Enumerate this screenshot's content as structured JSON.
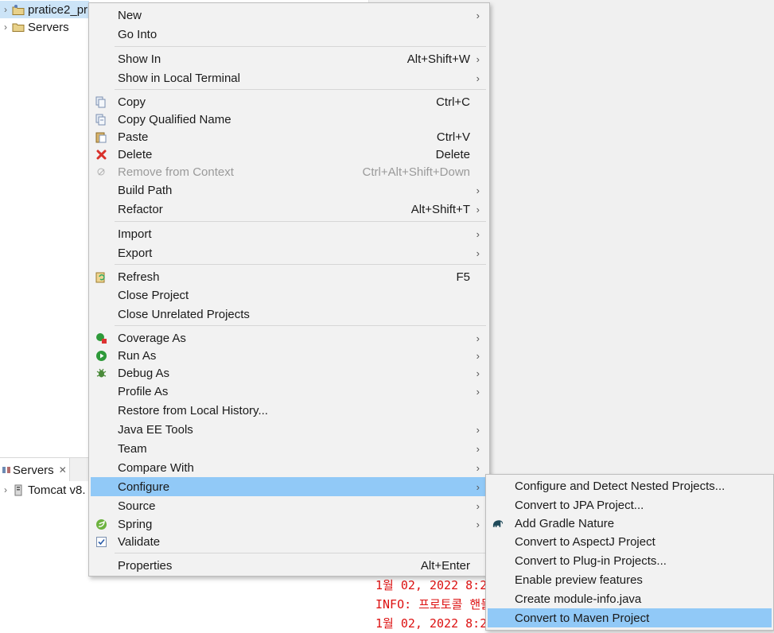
{
  "explorer": {
    "items": [
      {
        "label": "pratice2_pr",
        "selected": true
      },
      {
        "label": "Servers"
      }
    ]
  },
  "servers_view": {
    "tab_label": "Servers",
    "rows": [
      {
        "label": "Tomcat v8."
      }
    ]
  },
  "console": {
    "lines": [
      "1월 02, 2022 8:2",
      "INFO: 프로토콜 핸들",
      "1월 02, 2022 8:2"
    ]
  },
  "context_menu": {
    "items": [
      {
        "label": "New",
        "shortcut": "",
        "submenu": true
      },
      {
        "label": "Go Into",
        "shortcut": "",
        "submenu": false
      },
      {
        "label": "Show In",
        "shortcut": "Alt+Shift+W",
        "submenu": true
      },
      {
        "label": "Show in Local Terminal",
        "shortcut": "",
        "submenu": true
      },
      {
        "label": "Copy",
        "shortcut": "Ctrl+C",
        "icon": "copy-icon"
      },
      {
        "label": "Copy Qualified Name",
        "shortcut": "",
        "icon": "copy-qualified-name-icon"
      },
      {
        "label": "Paste",
        "shortcut": "Ctrl+V",
        "icon": "paste-icon"
      },
      {
        "label": "Delete",
        "shortcut": "Delete",
        "icon": "delete-icon"
      },
      {
        "label": "Remove from Context",
        "shortcut": "Ctrl+Alt+Shift+Down",
        "icon": "remove-context-icon",
        "disabled": true
      },
      {
        "label": "Build Path",
        "shortcut": "",
        "submenu": true
      },
      {
        "label": "Refactor",
        "shortcut": "Alt+Shift+T",
        "submenu": true
      },
      {
        "label": "Import",
        "shortcut": "",
        "submenu": true
      },
      {
        "label": "Export",
        "shortcut": "",
        "submenu": true
      },
      {
        "label": "Refresh",
        "shortcut": "F5",
        "icon": "refresh-icon"
      },
      {
        "label": "Close Project",
        "shortcut": ""
      },
      {
        "label": "Close Unrelated Projects",
        "shortcut": ""
      },
      {
        "label": "Coverage As",
        "shortcut": "",
        "submenu": true,
        "icon": "coverage-icon"
      },
      {
        "label": "Run As",
        "shortcut": "",
        "submenu": true,
        "icon": "run-icon"
      },
      {
        "label": "Debug As",
        "shortcut": "",
        "submenu": true,
        "icon": "debug-icon"
      },
      {
        "label": "Profile As",
        "shortcut": "",
        "submenu": true
      },
      {
        "label": "Restore from Local History...",
        "shortcut": ""
      },
      {
        "label": "Java EE Tools",
        "shortcut": "",
        "submenu": true
      },
      {
        "label": "Team",
        "shortcut": "",
        "submenu": true
      },
      {
        "label": "Compare With",
        "shortcut": "",
        "submenu": true
      },
      {
        "label": "Configure",
        "shortcut": "",
        "submenu": true,
        "highlighted": true
      },
      {
        "label": "Source",
        "shortcut": "",
        "submenu": true
      },
      {
        "label": "Spring",
        "shortcut": "",
        "submenu": true,
        "icon": "spring-icon"
      },
      {
        "label": "Validate",
        "shortcut": "",
        "icon": "validate-checkbox-icon"
      },
      {
        "label": "Properties",
        "shortcut": "Alt+Enter"
      }
    ]
  },
  "configure_submenu": {
    "items": [
      {
        "label": "Configure and Detect Nested Projects..."
      },
      {
        "label": "Convert to JPA Project..."
      },
      {
        "label": "Add Gradle Nature",
        "icon": "gradle-elephant-icon"
      },
      {
        "label": "Convert to AspectJ Project"
      },
      {
        "label": "Convert to Plug-in Projects..."
      },
      {
        "label": "Enable preview features"
      },
      {
        "label": "Create module-info.java"
      },
      {
        "label": "Convert to Maven Project",
        "highlighted": true
      }
    ]
  },
  "colors": {
    "menu_bg": "#f2f2f2",
    "highlight": "#91c9f7",
    "console_text": "#dd1111",
    "disabled_text": "#9a9a9a"
  }
}
